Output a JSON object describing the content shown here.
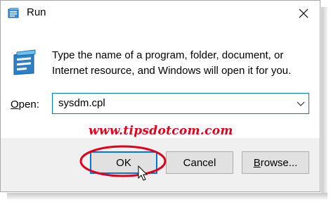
{
  "window": {
    "title": "Run",
    "title_icon": "run-icon",
    "close_icon": "close-icon"
  },
  "message": {
    "line1": "Type the name of a program, folder, document, or",
    "line2": "Internet resource, and Windows will open it for you."
  },
  "open_field": {
    "label_prefix": "",
    "label_underlined": "O",
    "label_rest": "pen:",
    "value": "sysdm.cpl",
    "dropdown_icon": "chevron-down-icon"
  },
  "watermark": "www.tipsdotcom.com",
  "buttons": {
    "ok": "OK",
    "cancel": "Cancel",
    "browse_underlined": "B",
    "browse_rest": "rowse..."
  },
  "colors": {
    "accent": "#0078d7",
    "highlight": "#e0001a",
    "footer_bg": "#f0f0f0"
  }
}
